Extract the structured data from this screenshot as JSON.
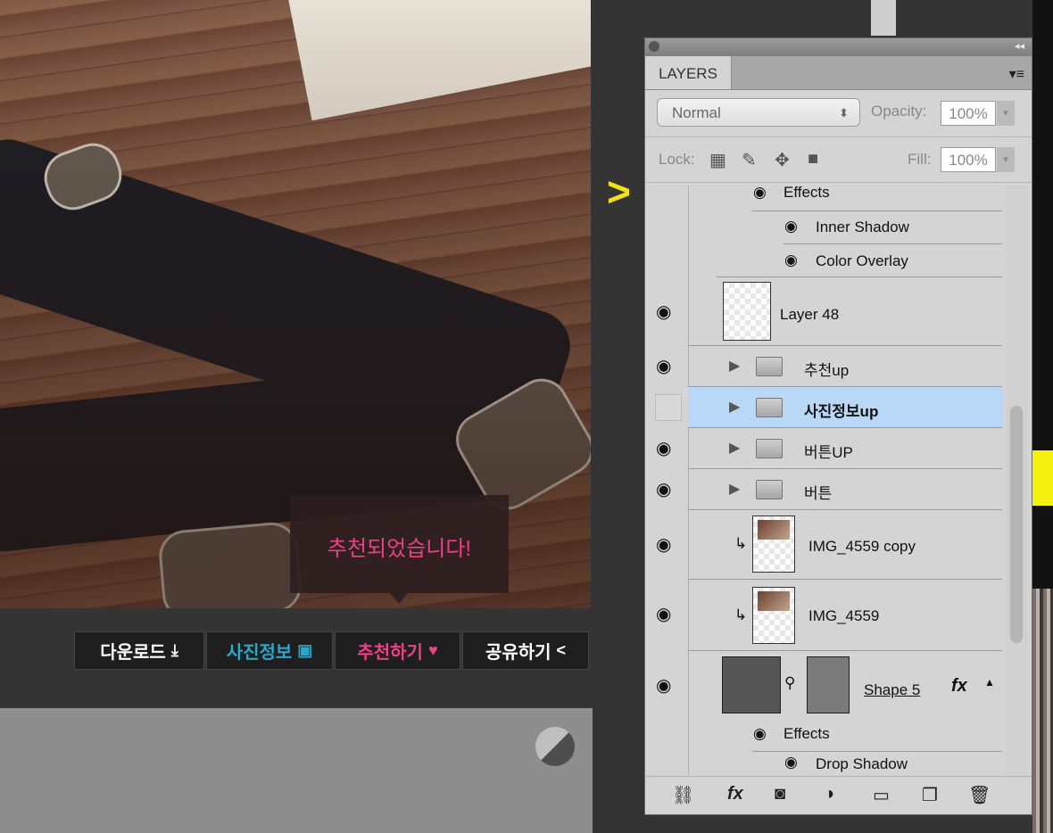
{
  "tooltip": {
    "text": "추천되었습니다!"
  },
  "buttons": [
    {
      "label": "다운로드",
      "icon": "download-icon",
      "color": "#ffffff"
    },
    {
      "label": "사진정보",
      "icon": "image-icon",
      "color": "#2aa7c9"
    },
    {
      "label": "추천하기",
      "icon": "heart-icon",
      "color": "#ef3f8a"
    },
    {
      "label": "공유하기",
      "icon": "share-icon",
      "color": "#ffffff"
    }
  ],
  "panel": {
    "tab": "LAYERS",
    "blend_mode": "Normal",
    "opacity_label": "Opacity:",
    "opacity_value": "100%",
    "lock_label": "Lock:",
    "fill_label": "Fill:",
    "fill_value": "100%",
    "layers": [
      {
        "name": "Effects"
      },
      {
        "name": "Inner Shadow"
      },
      {
        "name": "Color Overlay"
      },
      {
        "name": "Layer 48"
      },
      {
        "name": "추천up"
      },
      {
        "name": "사진정보up"
      },
      {
        "name": "버튼UP"
      },
      {
        "name": "버튼"
      },
      {
        "name": "IMG_4559 copy"
      },
      {
        "name": "IMG_4559"
      },
      {
        "name": "Shape 5"
      },
      {
        "name": "Effects"
      },
      {
        "name": "Drop Shadow"
      }
    ]
  },
  "colors": {
    "selected_row": "#b9d8f7",
    "accent_pink": "#ef3f8a",
    "accent_teal": "#2aa7c9",
    "chevron": "#f2e11a"
  }
}
